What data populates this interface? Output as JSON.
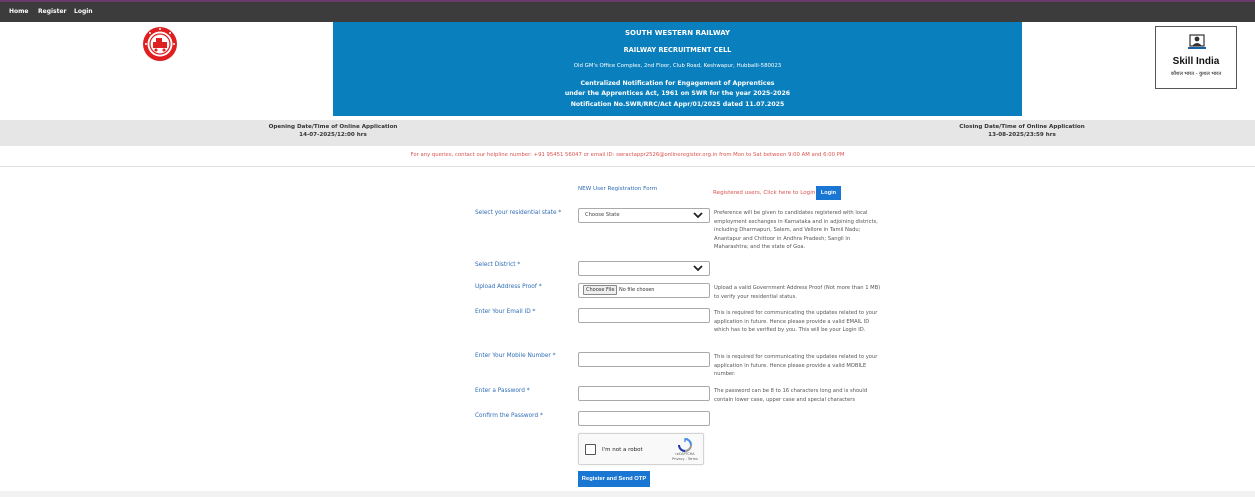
{
  "nav": {
    "items": [
      "Home",
      "Register",
      "Login"
    ]
  },
  "header": {
    "org": "SOUTH WESTERN RAILWAY",
    "cell": "RAILWAY RECRUITMENT CELL",
    "address": "Old GM's Office Complex, 2nd Floor, Club Road, Keshwapur, Hubballi-580023",
    "notice_line1": "Centralized Notification for Engagement of Apprentices",
    "notice_line2": "under the Apprentices Act, 1961 on SWR for the year 2025-2026",
    "notice_line3": "Notification No.SWR/RRC/Act Appr/01/2025 dated 11.07.2025",
    "skill_logo_text": "Skill India",
    "skill_logo_subtext": "कौशल भारत - कुशल भारत"
  },
  "dates": {
    "opening_label": "Opening Date/Time of Online Application",
    "opening_value": "14-07-2025/12:00 hrs",
    "closing_label": "Closing Date/Time of Online Application",
    "closing_value": "13-08-2025/23:59 hrs"
  },
  "helpline": "For any queries, contact our helpline number: +91 95451 56047 or email ID: swractappr2526@onlineregister.org.in from Mon to Sat between 9:00 AM and 6:00 PM",
  "form": {
    "title": "NEW User Registration Form",
    "registered_text": "Registered users, Click here to Login",
    "login_button": "Login",
    "state_label": "Select your residential state *",
    "state_value": "Choose State",
    "state_hint": "Preference will be given to candidates registered with local employment exchanges in Karnataka and in adjoining districts, including Dharmapuri, Salem, and Vellore in Tamil Nadu; Anantapur and Chittoor in Andhra Pradesh; Sangli in Maharashtra; and the state of Goa.",
    "district_label": "Select District *",
    "district_value": "",
    "address_label": "Upload Address Proof *",
    "file_button": "Choose File",
    "file_status": "No file chosen",
    "address_hint": "Upload a valid Government Address Proof (Not more than 1 MB) to verify your residential status.",
    "email_label": "Enter Your Email ID *",
    "email_value": "",
    "email_hint": "This is required for communicating the updates related to your application in future. Hence please provide a valid EMAIL ID which has to be verified by you. This will be your Login ID.",
    "mobile_label": "Enter Your Mobile Number *",
    "mobile_value": "",
    "mobile_hint": "This is required for communicating the updates related to your application in future. Hence please provide a valid MOBILE number.",
    "password_label": "Enter a Password *",
    "password_value": "",
    "password_hint": "The password can be 8 to 16 characters long and is should contain lower case, upper case and special characters",
    "confirm_label": "Confirm the Password *",
    "confirm_value": "",
    "captcha_label": "I'm not a robot",
    "captcha_brand": "reCAPTCHA",
    "captcha_links": "Privacy - Terms",
    "submit_button": "Register and Send OTP"
  },
  "colors": {
    "nav_bg": "#3c3c3c",
    "banner_bg": "#0a7fbd",
    "accent_blue": "#1976d2",
    "label_blue": "#2f6db5",
    "alert_red": "#d9534f"
  }
}
